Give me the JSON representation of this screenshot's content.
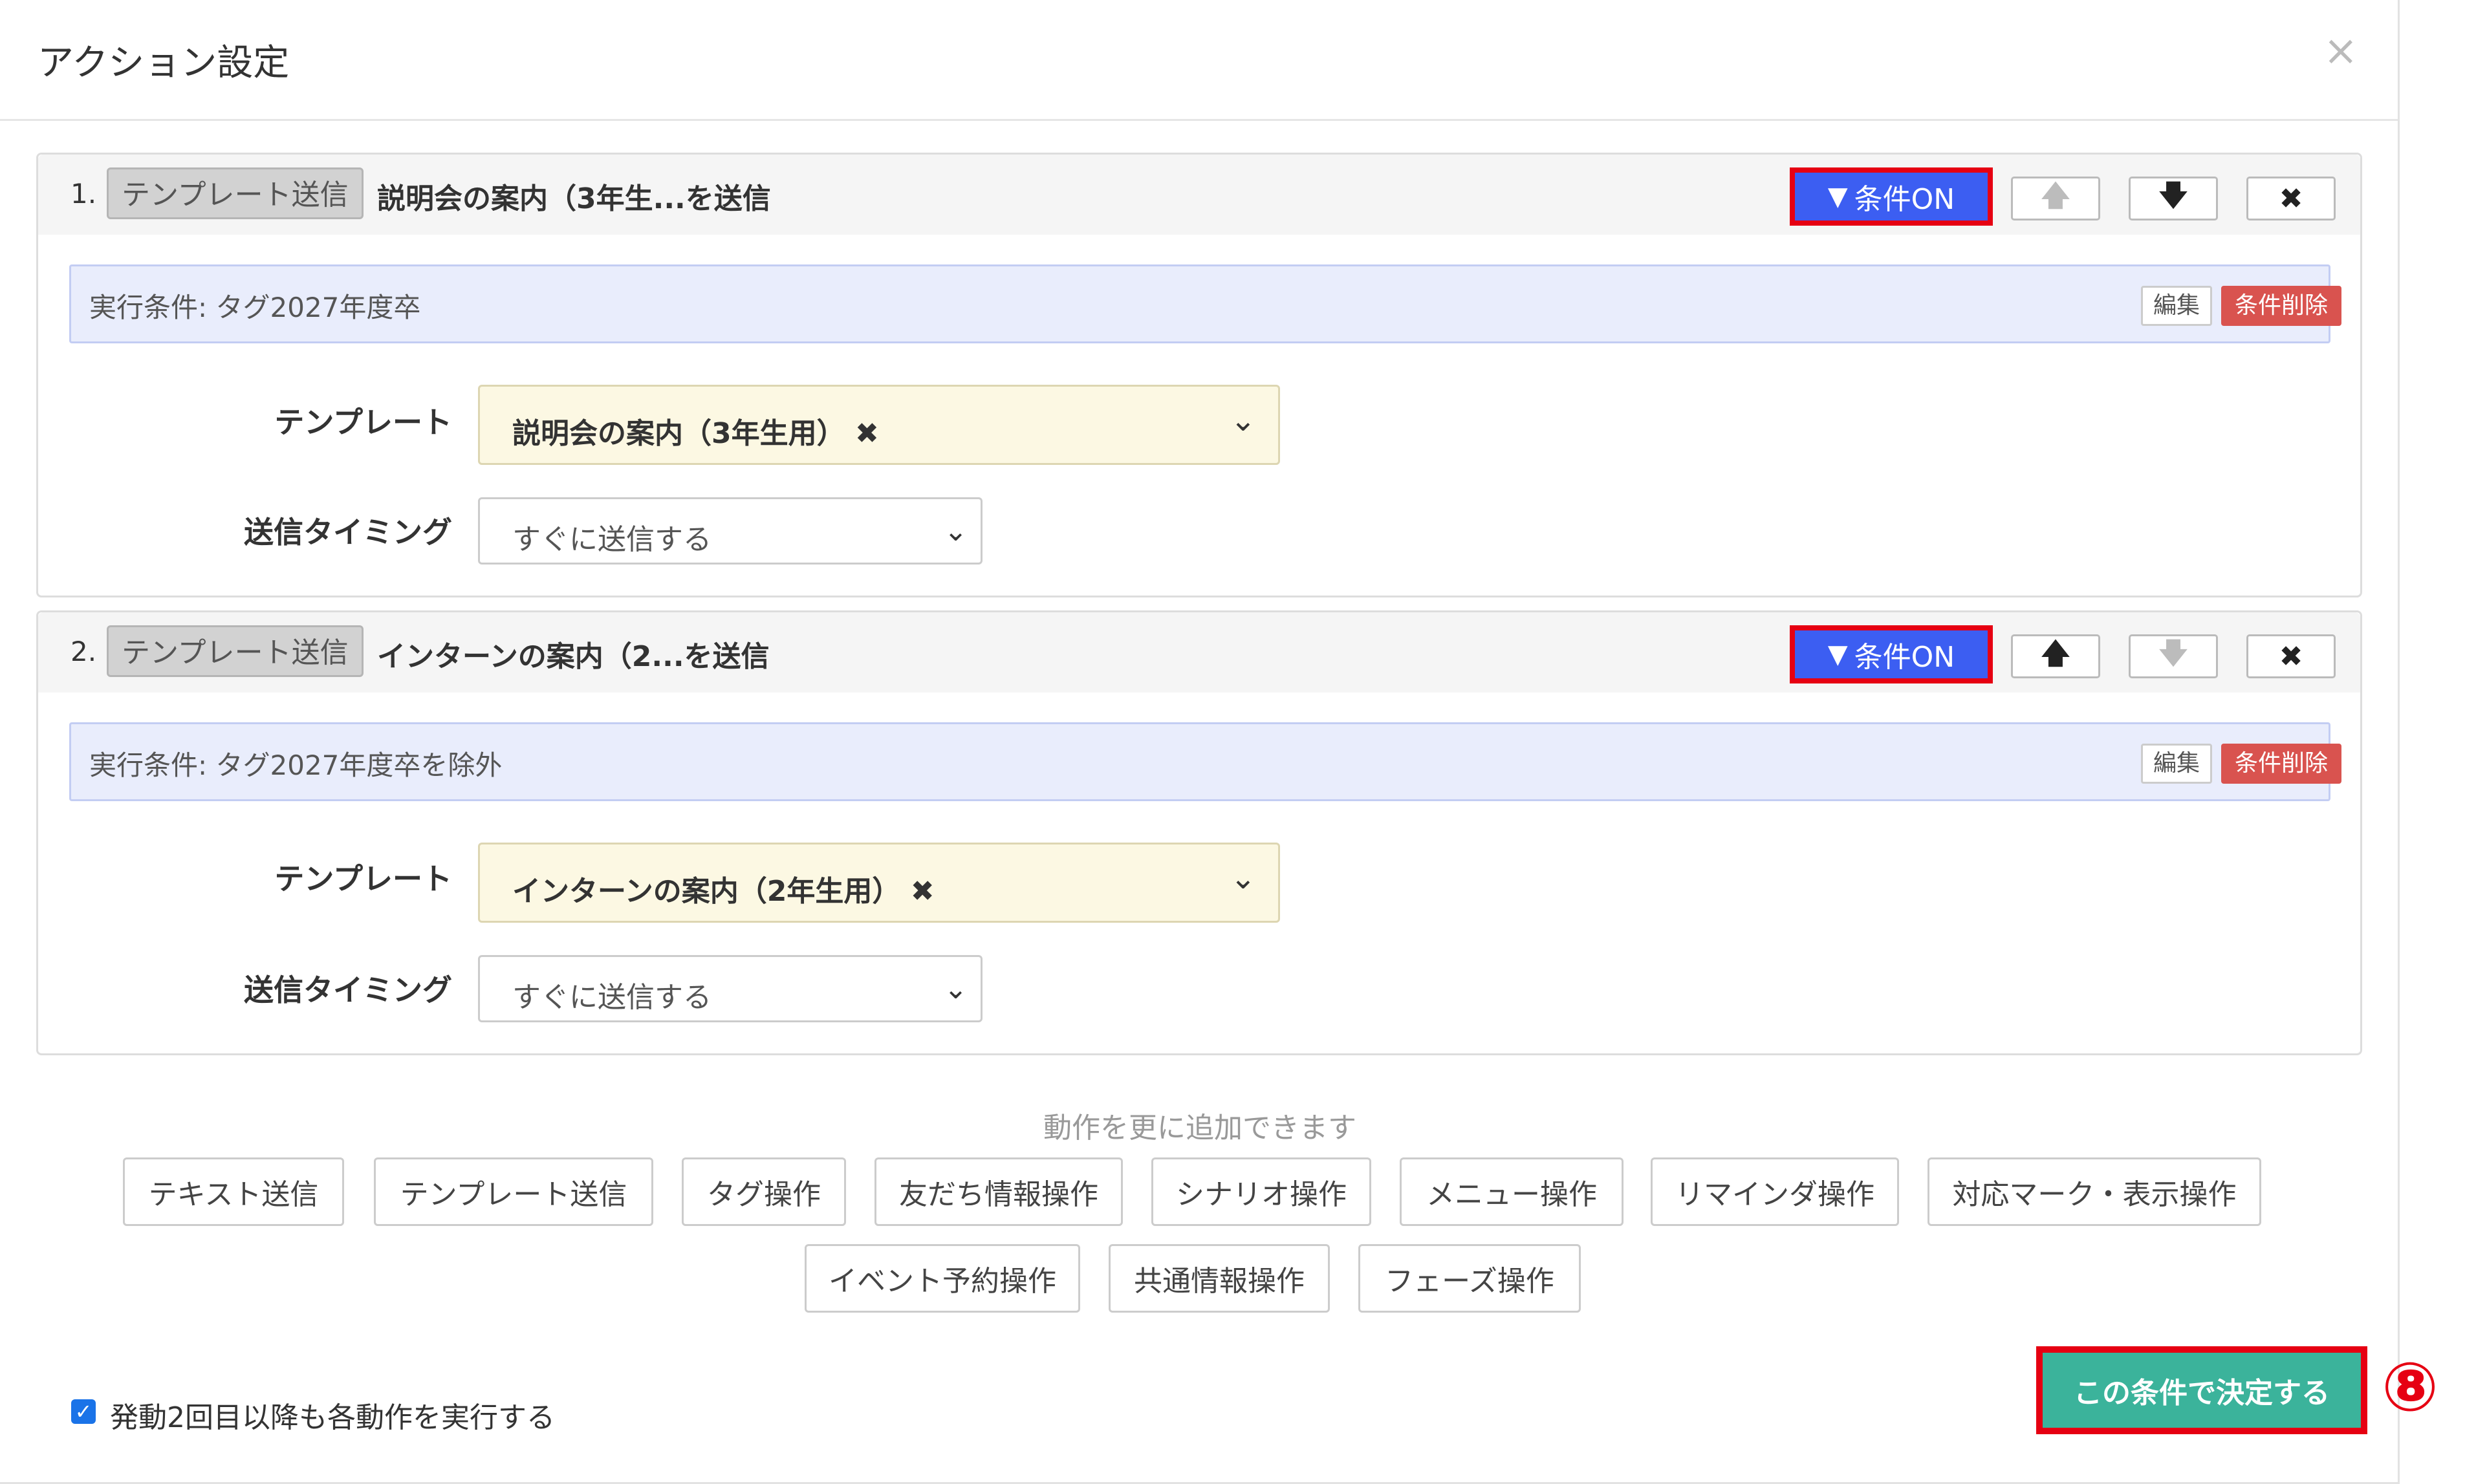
{
  "modal": {
    "title": "アクション設定",
    "close": "×"
  },
  "actions": [
    {
      "number": "1.",
      "type": "テンプレート送信",
      "name": "説明会の案内（3年生...を送信",
      "condition_button": "条件ON",
      "up": "🡅",
      "down": "🡇",
      "remove": "✖",
      "condition_text": "実行条件: タグ2027年度卒",
      "edit": "編集",
      "condition_delete": "条件削除",
      "template_label": "テンプレート",
      "template_value": "説明会の案内（3年生用）",
      "template_clear": "✖",
      "timing_label": "送信タイミング",
      "timing_value": "すぐに送信する"
    },
    {
      "number": "2.",
      "type": "テンプレート送信",
      "name": "インターンの案内（2...を送信",
      "condition_button": "条件ON",
      "up": "🡅",
      "down": "🡇",
      "remove": "✖",
      "condition_text": "実行条件: タグ2027年度卒を除外",
      "edit": "編集",
      "condition_delete": "条件削除",
      "template_label": "テンプレート",
      "template_value": "インターンの案内（2年生用）",
      "template_clear": "✖",
      "timing_label": "送信タイミング",
      "timing_value": "すぐに送信する"
    }
  ],
  "add_actions": {
    "hint": "動作を更に追加できます",
    "buttons": [
      "テキスト送信",
      "テンプレート送信",
      "タグ操作",
      "友だち情報操作",
      "シナリオ操作",
      "メニュー操作",
      "リマインダ操作",
      "対応マーク・表示操作",
      "イベント予約操作",
      "共通情報操作",
      "フェーズ操作"
    ]
  },
  "footer": {
    "checkbox_label": "発動2回目以降も各動作を実行する",
    "checked": true,
    "submit": "この条件で決定する",
    "step_marker": "⑧"
  },
  "colors": {
    "condition_on": "#3c5ef2",
    "highlight": "#e60012",
    "submit": "#3bb39b",
    "delete": "#d9534f"
  }
}
